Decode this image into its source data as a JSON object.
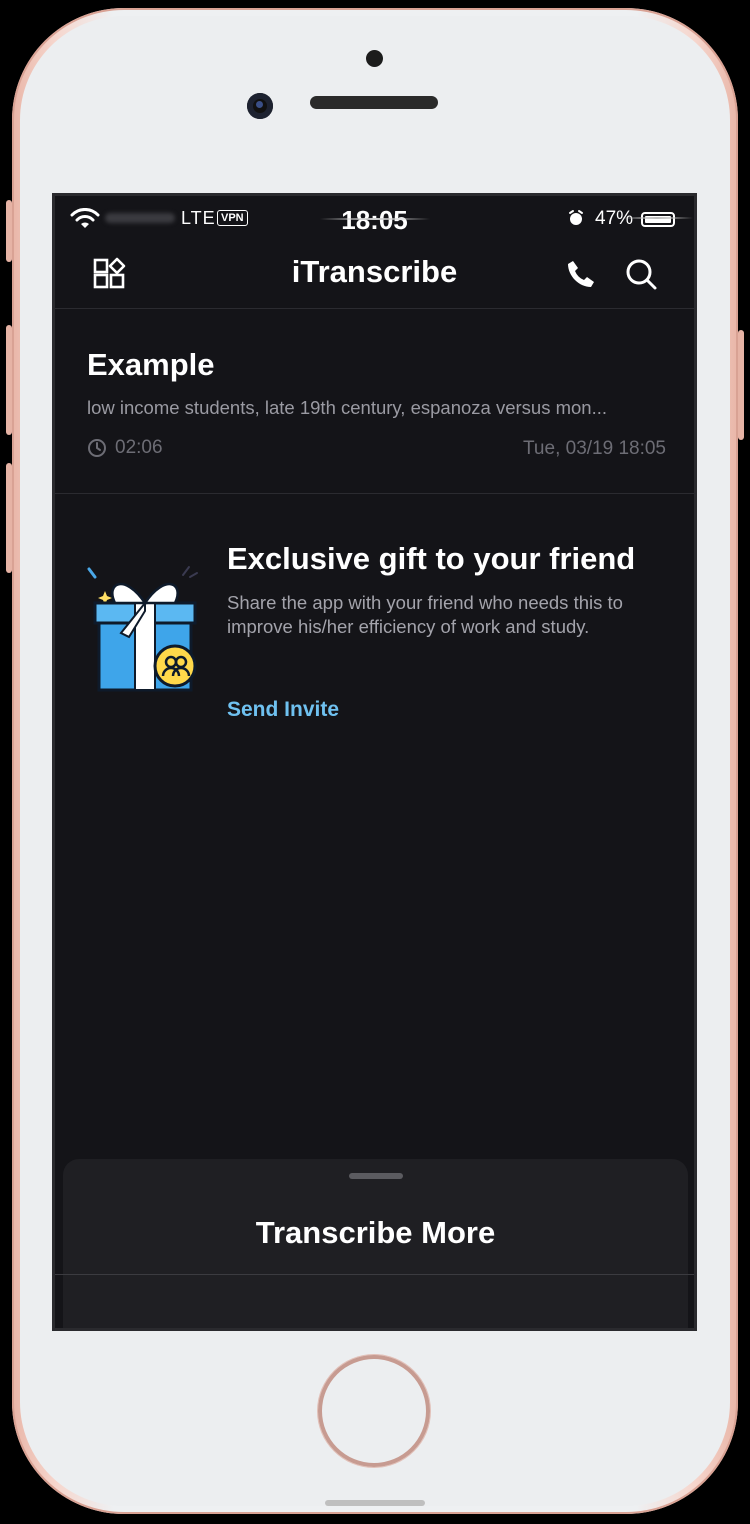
{
  "status_bar": {
    "network": "LTE",
    "vpn": "VPN",
    "time": "18:05",
    "battery": "47%",
    "icons": [
      "wifi-icon",
      "alarm-icon",
      "battery-icon"
    ]
  },
  "navbar": {
    "title": "iTranscribe",
    "icons": [
      "apps-grid-icon",
      "phone-icon",
      "search-icon"
    ]
  },
  "recording": {
    "title": "Example",
    "snippet": "low income students, late 19th century, espanoza versus mon...",
    "duration": "02:06",
    "date": "Tue, 03/19 18:05",
    "duration_icon": "clock-icon"
  },
  "promo": {
    "title": "Exclusive gift to your friend",
    "body": "Share the app with your friend who needs this to improve his/her efficiency of work and study.",
    "link": "Send Invite",
    "image": "gift-illustration",
    "accent": "#6fc1f0"
  },
  "bottom_sheet": {
    "title": "Transcribe More"
  },
  "colors": {
    "background": "#141418",
    "text_primary": "#ffffff",
    "text_secondary": "#9a9aa2",
    "link": "#6fc1f0"
  }
}
